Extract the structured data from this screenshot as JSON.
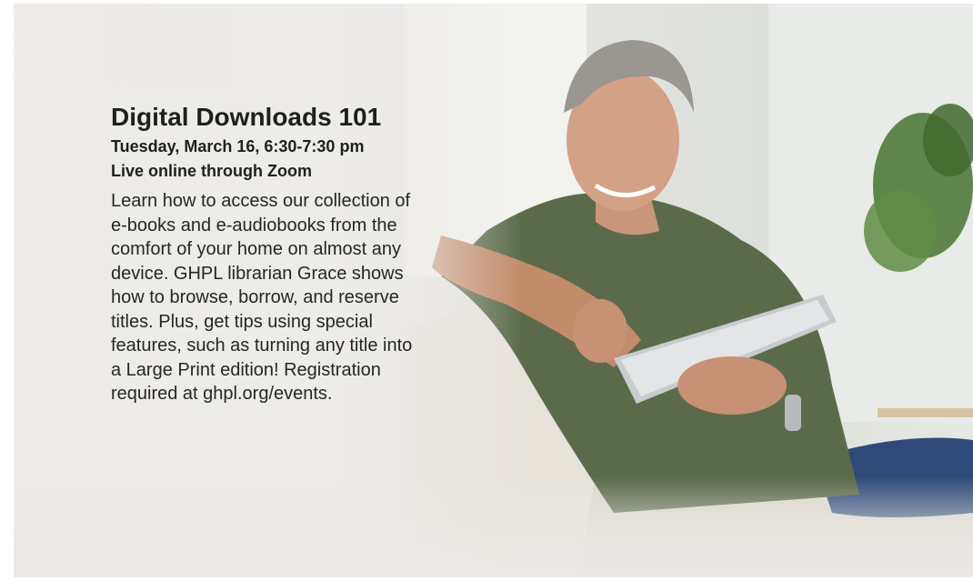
{
  "event": {
    "title": "Digital Downloads 101",
    "datetime": "Tuesday, March 16, 6:30-7:30 pm",
    "location": "Live online through Zoom",
    "description": "Learn how to access our collection of e-books and e-audiobooks from the comfort of your home on almost any device. GHPL librarian Grace shows how to browse, borrow, and reserve titles. Plus, get tips using special features, such as turning any title into a Large Print edition! Registration required at ghpl.org/events."
  },
  "photo": {
    "subject": "man-using-tablet-on-sofa",
    "colors": {
      "shirt": "#5b6b4a",
      "sofa": "#e7e3db",
      "background": "#e9e6e2",
      "plant": "#4f7a3a"
    }
  }
}
